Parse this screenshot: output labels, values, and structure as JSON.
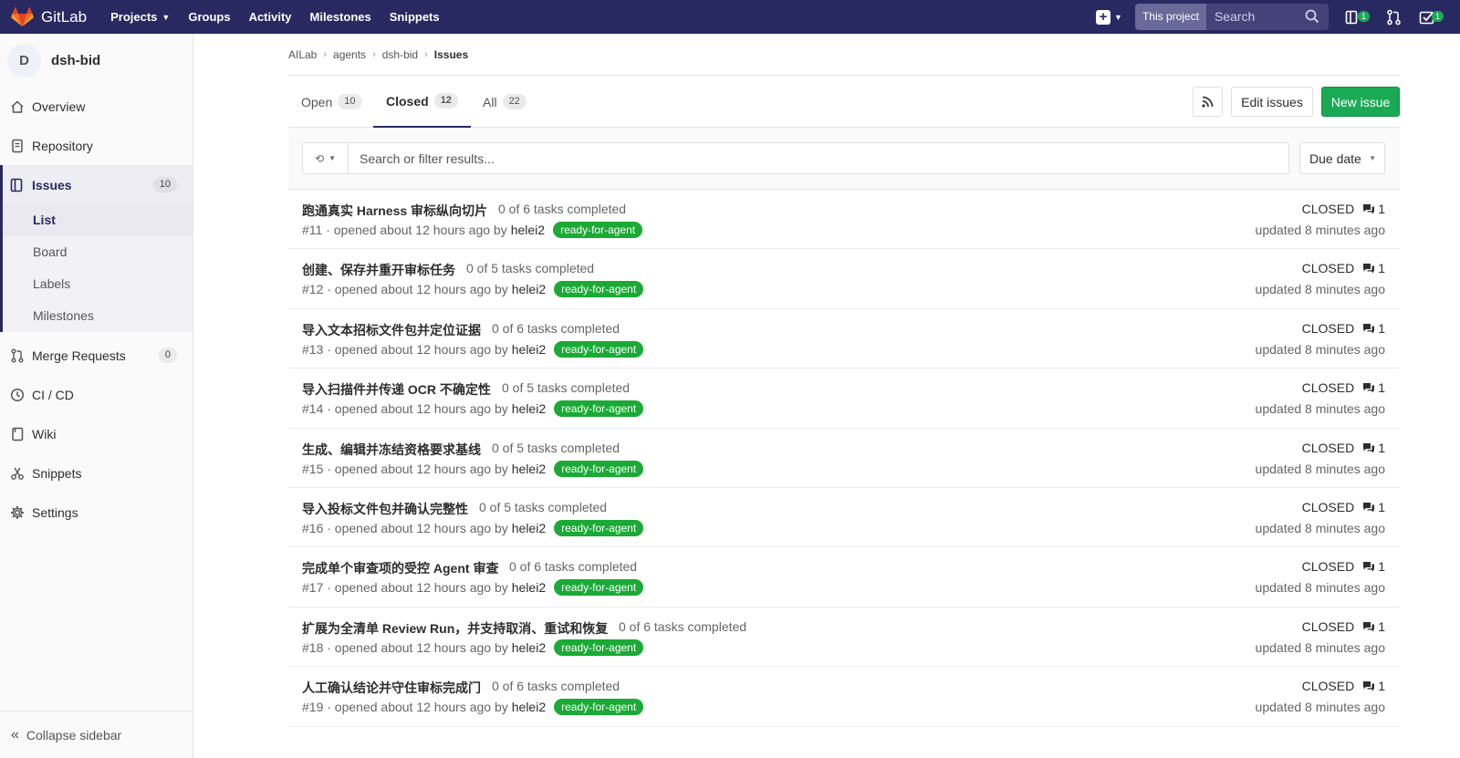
{
  "navbar": {
    "brand": "GitLab",
    "links": [
      {
        "label": "Projects",
        "has_caret": true
      },
      {
        "label": "Groups"
      },
      {
        "label": "Activity"
      },
      {
        "label": "Milestones"
      },
      {
        "label": "Snippets"
      }
    ],
    "search_scope": "This project",
    "search_placeholder": "Search",
    "issues_badge": "1",
    "todos_badge": "1"
  },
  "sidebar": {
    "avatar_letter": "D",
    "project_name": "dsh-bid",
    "overview": "Overview",
    "repository": "Repository",
    "issues": {
      "label": "Issues",
      "count": "10"
    },
    "issue_subitems": [
      "List",
      "Board",
      "Labels",
      "Milestones"
    ],
    "merge_requests": {
      "label": "Merge Requests",
      "count": "0"
    },
    "cicd": "CI / CD",
    "wiki": "Wiki",
    "snippets": "Snippets",
    "settings": "Settings",
    "collapse": "Collapse sidebar"
  },
  "breadcrumb": [
    "AILab",
    "agents",
    "dsh-bid",
    "Issues"
  ],
  "tabs": [
    {
      "label": "Open",
      "count": "10"
    },
    {
      "label": "Closed",
      "count": "12"
    },
    {
      "label": "All",
      "count": "22"
    }
  ],
  "buttons": {
    "edit": "Edit issues",
    "new": "New issue"
  },
  "filter": {
    "placeholder": "Search or filter results...",
    "sort": "Due date"
  },
  "colors": {
    "navbar": "#292961",
    "accent_green": "#1aaa55",
    "label_green": "#1aaa35"
  },
  "issues": [
    {
      "title": "跑通真实 Harness 审标纵向切片",
      "tasks": "0 of 6 tasks completed",
      "meta": "#11 · opened about 12 hours ago by",
      "author": "helei2",
      "label": "ready-for-agent",
      "status": "CLOSED",
      "comments": "1",
      "updated": "updated 8 minutes ago"
    },
    {
      "title": "创建、保存并重开审标任务",
      "tasks": "0 of 5 tasks completed",
      "meta": "#12 · opened about 12 hours ago by",
      "author": "helei2",
      "label": "ready-for-agent",
      "status": "CLOSED",
      "comments": "1",
      "updated": "updated 8 minutes ago"
    },
    {
      "title": "导入文本招标文件包并定位证据",
      "tasks": "0 of 6 tasks completed",
      "meta": "#13 · opened about 12 hours ago by",
      "author": "helei2",
      "label": "ready-for-agent",
      "status": "CLOSED",
      "comments": "1",
      "updated": "updated 8 minutes ago"
    },
    {
      "title": "导入扫描件并传递 OCR 不确定性",
      "tasks": "0 of 5 tasks completed",
      "meta": "#14 · opened about 12 hours ago by",
      "author": "helei2",
      "label": "ready-for-agent",
      "status": "CLOSED",
      "comments": "1",
      "updated": "updated 8 minutes ago"
    },
    {
      "title": "生成、编辑并冻结资格要求基线",
      "tasks": "0 of 5 tasks completed",
      "meta": "#15 · opened about 12 hours ago by",
      "author": "helei2",
      "label": "ready-for-agent",
      "status": "CLOSED",
      "comments": "1",
      "updated": "updated 8 minutes ago"
    },
    {
      "title": "导入投标文件包并确认完整性",
      "tasks": "0 of 5 tasks completed",
      "meta": "#16 · opened about 12 hours ago by",
      "author": "helei2",
      "label": "ready-for-agent",
      "status": "CLOSED",
      "comments": "1",
      "updated": "updated 8 minutes ago"
    },
    {
      "title": "完成单个审查项的受控 Agent 审查",
      "tasks": "0 of 6 tasks completed",
      "meta": "#17 · opened about 12 hours ago by",
      "author": "helei2",
      "label": "ready-for-agent",
      "status": "CLOSED",
      "comments": "1",
      "updated": "updated 8 minutes ago"
    },
    {
      "title": "扩展为全清单 Review Run，并支持取消、重试和恢复",
      "tasks": "0 of 6 tasks completed",
      "meta": "#18 · opened about 12 hours ago by",
      "author": "helei2",
      "label": "ready-for-agent",
      "status": "CLOSED",
      "comments": "1",
      "updated": "updated 8 minutes ago"
    },
    {
      "title": "人工确认结论并守住审标完成门",
      "tasks": "0 of 6 tasks completed",
      "meta": "#19 · opened about 12 hours ago by",
      "author": "helei2",
      "label": "ready-for-agent",
      "status": "CLOSED",
      "comments": "1",
      "updated": "updated 8 minutes ago"
    }
  ]
}
